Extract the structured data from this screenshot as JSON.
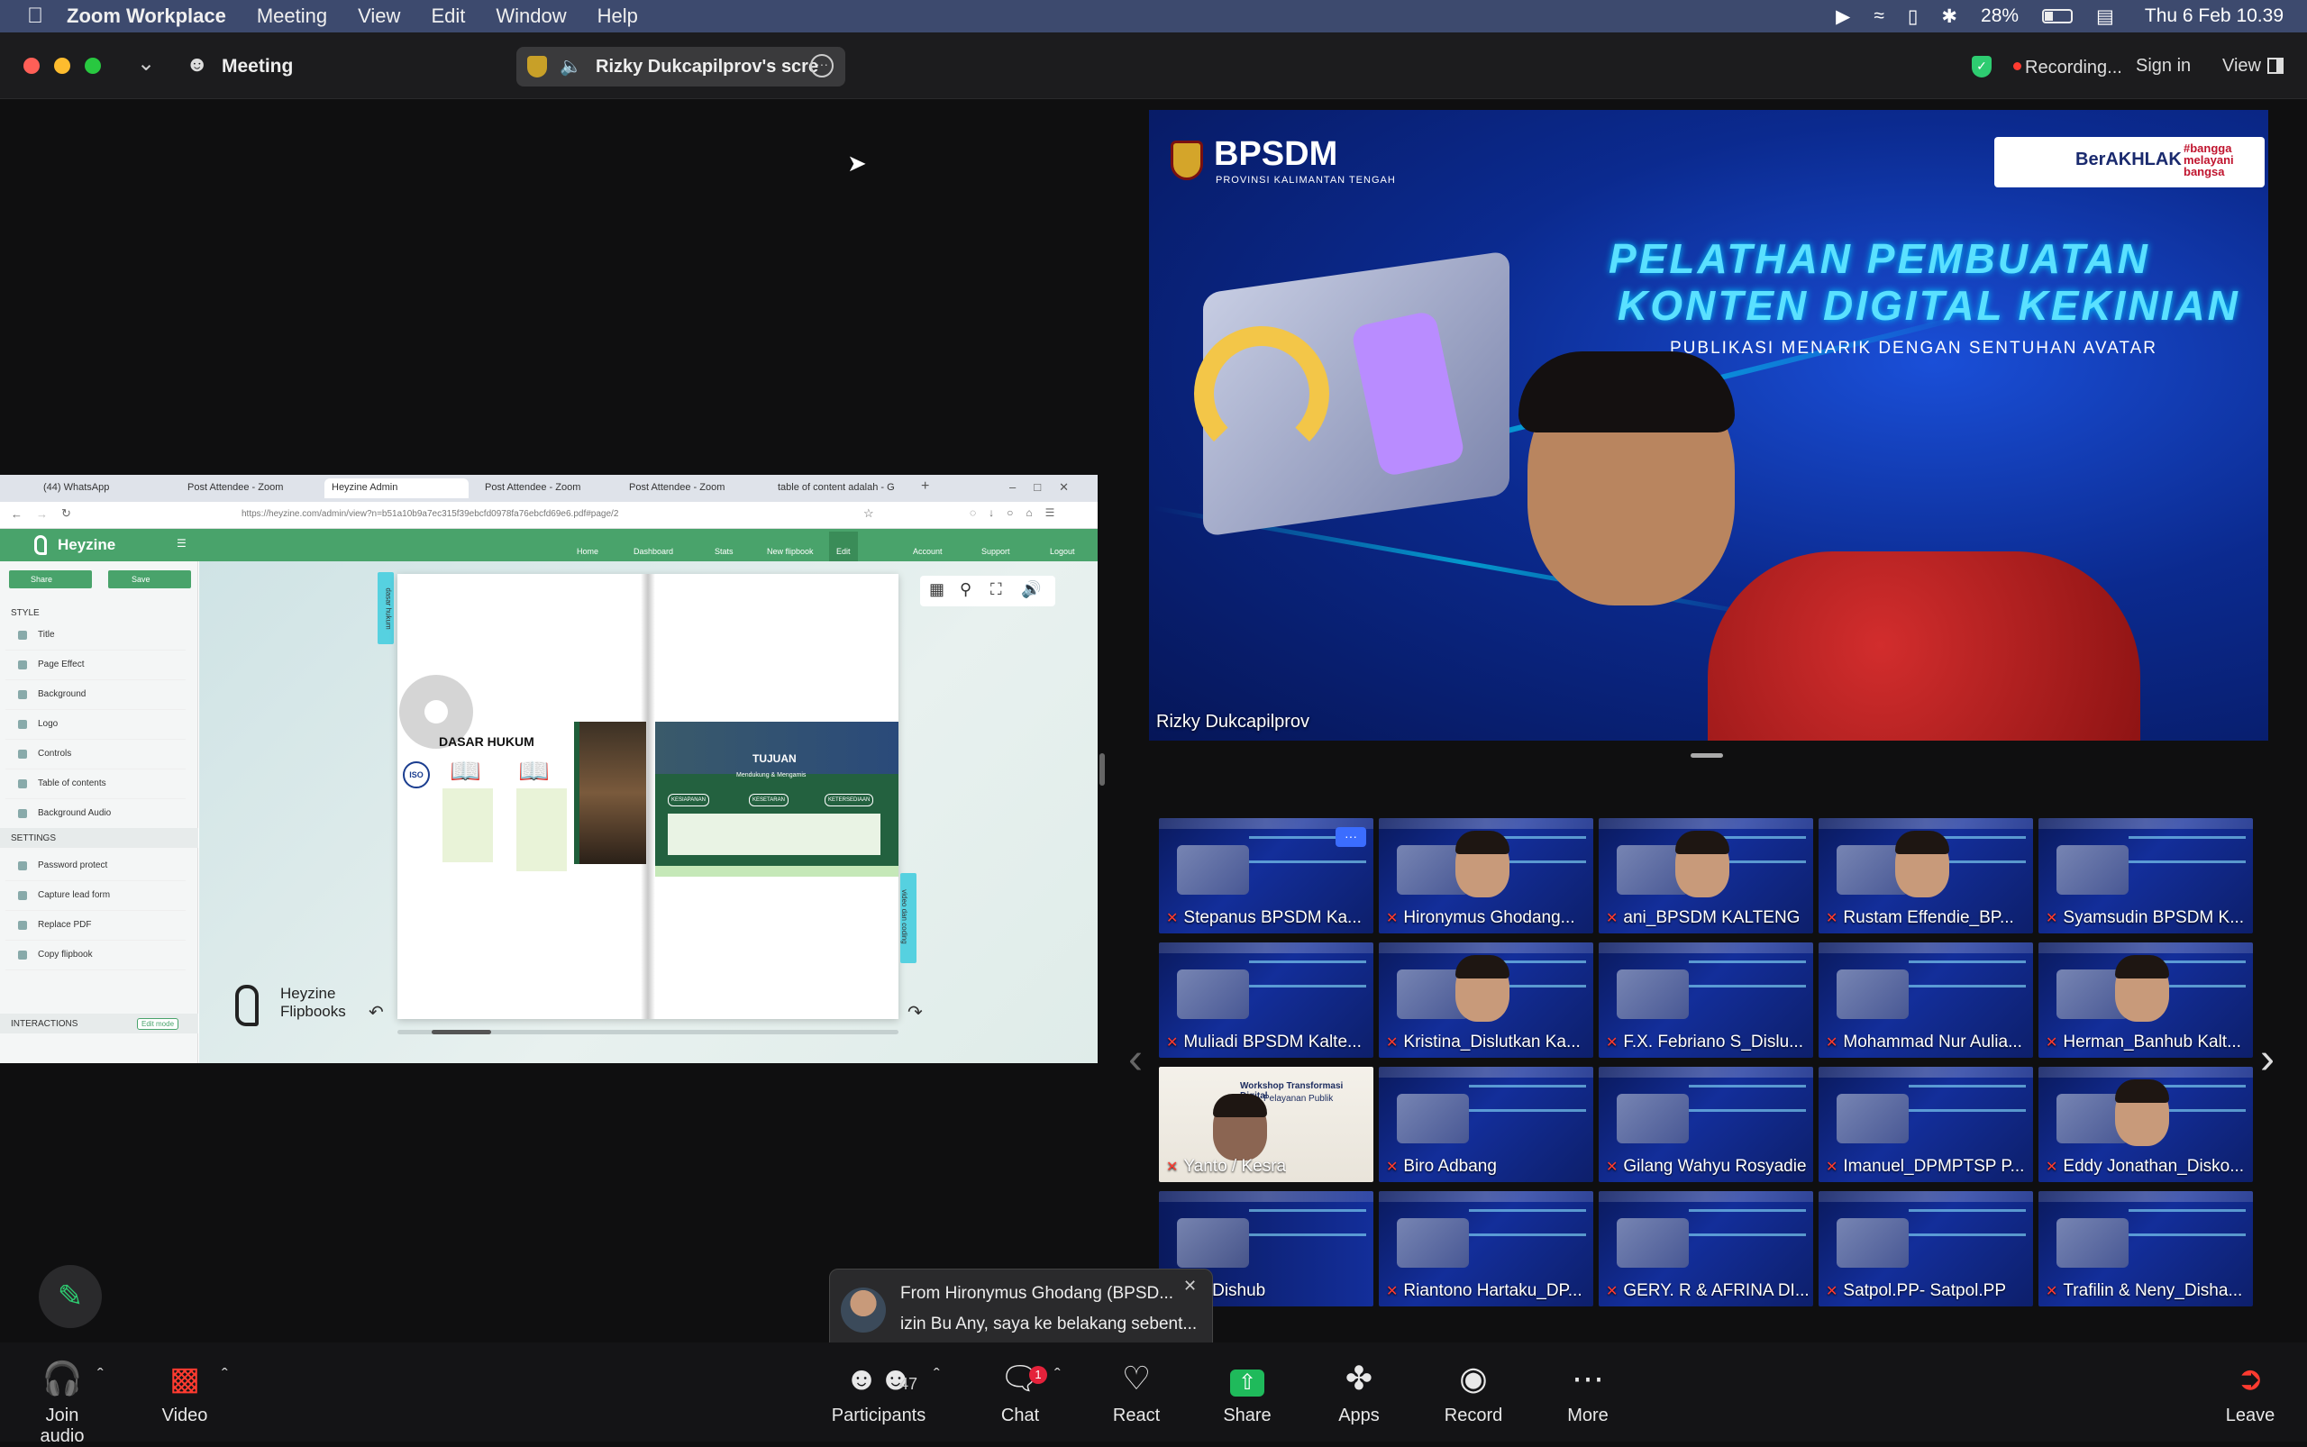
{
  "menubar": {
    "app": "Zoom Workplace",
    "items": [
      "Meeting",
      "View",
      "Edit",
      "Window",
      "Help"
    ],
    "battery": "28%",
    "clock": "Thu 6 Feb  10.39"
  },
  "titlebar": {
    "meeting_label": "Meeting",
    "share_pill": "Rizky Dukcapilprov's scre",
    "recording": "Recording...",
    "sign_in": "Sign in",
    "view": "View"
  },
  "shared_screen": {
    "tabs": [
      "(44) WhatsApp",
      "Post Attendee - Zoom",
      "Heyzine Admin",
      "Post Attendee - Zoom",
      "Post Attendee - Zoom",
      "table of content adalah - G"
    ],
    "url": "https://heyzine.com/admin/view?n=b51a10b9a7ec315f39ebcfd0978fa76ebcfd69e6.pdf#page/2",
    "brand": "Heyzine",
    "nav": [
      "Home",
      "Dashboard",
      "Stats",
      "New flipbook",
      "Edit",
      "Account",
      "Support",
      "Logout"
    ],
    "share_btn": "Share",
    "save_btn": "Save",
    "style_header": "STYLE",
    "style_items": [
      "Title",
      "Page Effect",
      "Background",
      "Logo",
      "Controls",
      "Table of contents",
      "Background Audio"
    ],
    "settings_header": "SETTINGS",
    "settings_items": [
      "Password protect",
      "Capture lead form",
      "Replace PDF",
      "Copy flipbook"
    ],
    "interactions_header": "INTERACTIONS",
    "edit_mode": "Edit mode",
    "tab_left": "dasar hukum",
    "tab_right": "video dan coding",
    "page_title_left": "DASAR HUKUM",
    "page_title_right": "TUJUAN",
    "tujuan_sub": "Mendukung & Mengamis",
    "tujuan_boxes": [
      "KESIAPANAN",
      "KESETARAN",
      "KETERSEDIAAN"
    ],
    "logo_line1": "Heyzine",
    "logo_line2": "Flipbooks"
  },
  "speaker": {
    "name": "Rizky Dukcapilprov",
    "banner_org": "BPSDM",
    "banner_sub": "PROVINSI KALIMANTAN TENGAH",
    "headline1": "PELATHAN PEMBUATAN",
    "headline2": "KONTEN DIGITAL KEKINIAN",
    "tagline": "PUBLIKASI MENARIK DENGAN SENTUHAN AVATAR",
    "badge": "BerAKHLAK",
    "badge2": "#bangga melayani bangsa"
  },
  "participants": [
    {
      "name": "Stepanus BPSDM  Ka...",
      "face": false
    },
    {
      "name": "Hironymus Ghodang...",
      "face": true
    },
    {
      "name": "ani_BPSDM KALTENG",
      "face": true
    },
    {
      "name": "Rustam Effendie_BP...",
      "face": true
    },
    {
      "name": "Syamsudin BPSDM K...",
      "face": false
    },
    {
      "name": "Muliadi BPSDM Kalte...",
      "face": false
    },
    {
      "name": "Kristina_Dislutkan Ka...",
      "face": true
    },
    {
      "name": "F.X. Febriano S_Dislu...",
      "face": false
    },
    {
      "name": "Mohammad Nur Aulia...",
      "face": false
    },
    {
      "name": "Herman_Banhub Kalt...",
      "face": true
    },
    {
      "name": "Yanto / Kesra",
      "face": true
    },
    {
      "name": "Biro Adbang",
      "face": false
    },
    {
      "name": "Gilang Wahyu Rosyadie",
      "face": false
    },
    {
      "name": "Imanuel_DPMPTSP P...",
      "face": false
    },
    {
      "name": "Eddy Jonathan_Disko...",
      "face": true
    },
    {
      "name": "an_Dishub",
      "face": false
    },
    {
      "name": "Riantono Hartaku_DP...",
      "face": false
    },
    {
      "name": "GERY. R & AFRINA DI...",
      "face": false
    },
    {
      "name": "Satpol.PP- Satpol.PP",
      "face": false
    },
    {
      "name": "Trafilin & Neny_Disha...",
      "face": false
    }
  ],
  "yanto_tile": {
    "title": "Workshop Transformasi Digital",
    "subtitle": "Pelayanan Publik"
  },
  "chat_toast": {
    "from": "From Hironymus Ghodang (BPSD...",
    "message": "izin Bu Any, saya ke belakang sebent..."
  },
  "toolbar": {
    "join_audio": "Join audio",
    "video": "Video",
    "participants": "Participants",
    "participant_count": "47",
    "chat": "Chat",
    "chat_badge": "1",
    "react": "React",
    "share": "Share",
    "apps": "Apps",
    "record": "Record",
    "more": "More",
    "leave": "Leave"
  }
}
